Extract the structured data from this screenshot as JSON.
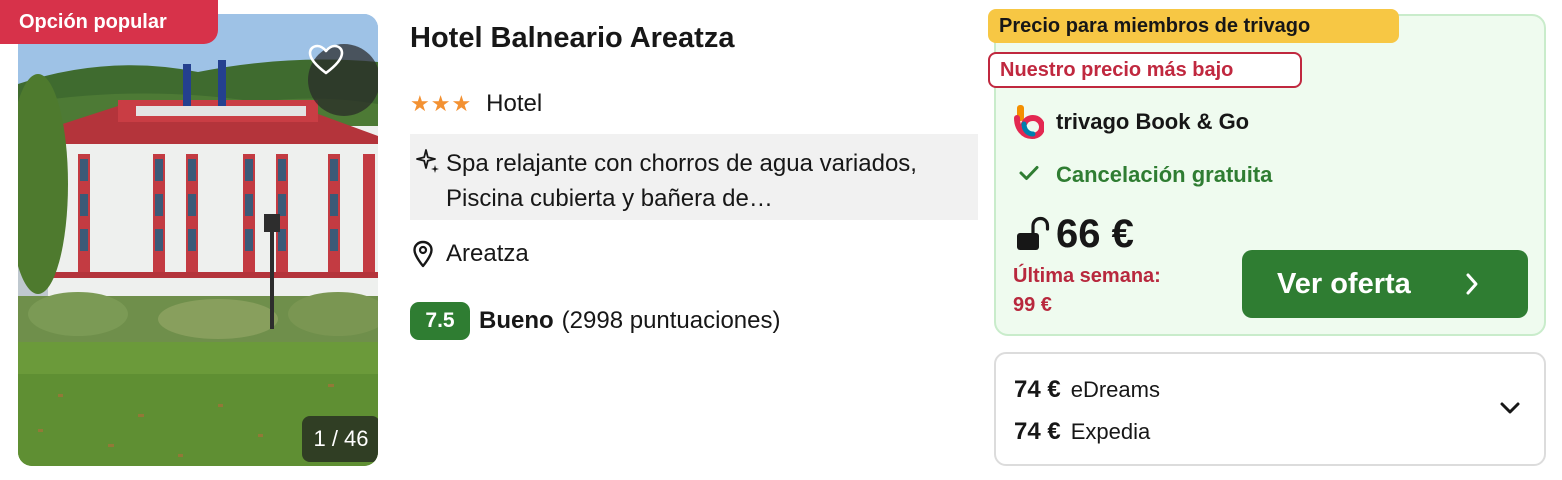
{
  "badges": {
    "popular": "Opción popular",
    "members": "Precio para miembros de trivago",
    "lowest": "Nuestro precio más bajo"
  },
  "photo": {
    "counter": "1 / 46"
  },
  "hotel": {
    "name": "Hotel Balneario Areatza",
    "stars": "★★★",
    "star_count": 3,
    "type": "Hotel",
    "amenities": "Spa relajante con chorros de agua variados, Piscina cubierta y bañera de…",
    "location": "Areatza",
    "score": "7.5",
    "score_label": "Bueno",
    "score_count": "(2998 puntuaciones)"
  },
  "deal": {
    "provider": "trivago Book & Go",
    "cancellation": "Cancelación gratuita",
    "price": "66 €",
    "last_week_label": "Última semana:",
    "last_week_price": "99 €",
    "cta": "Ver oferta"
  },
  "offers": [
    {
      "price": "74 €",
      "provider": "eDreams"
    },
    {
      "price": "74 €",
      "provider": "Expedia"
    }
  ],
  "colors": {
    "brand_green": "#2f7d32",
    "popular_red": "#d7324a",
    "member_yellow": "#f7c744",
    "deal_bg": "#effbef",
    "star_orange": "#f39132"
  },
  "icons": [
    "heart-icon",
    "sparkle-icon",
    "location-pin-icon",
    "trivago-logo-icon",
    "check-icon",
    "lock-open-icon",
    "chevron-right-icon",
    "chevron-down-icon"
  ]
}
